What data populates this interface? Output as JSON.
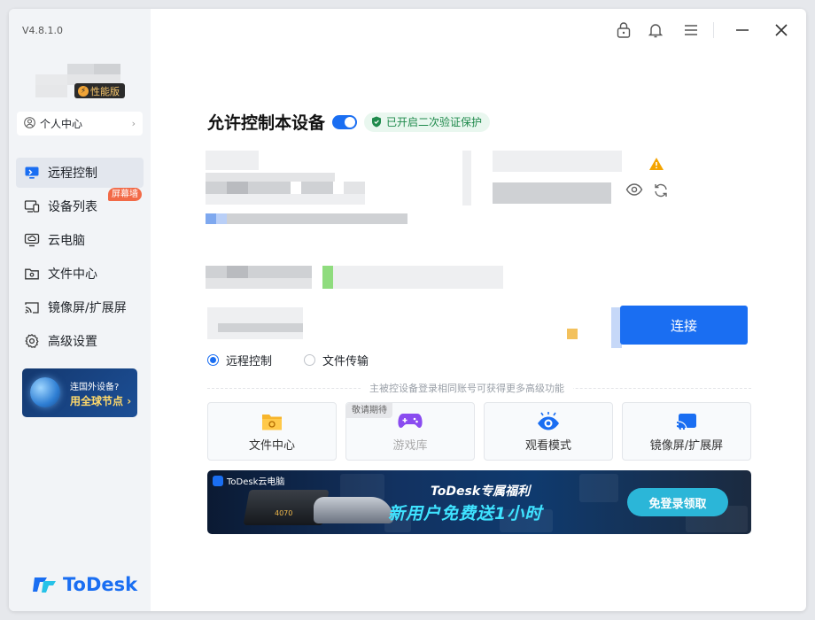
{
  "version": "V4.8.1.0",
  "badge": {
    "perf": "性能版"
  },
  "personal_center": "个人中心",
  "nav": [
    {
      "label": "远程控制",
      "icon": "monitor-icon",
      "active": true
    },
    {
      "label": "设备列表",
      "icon": "devices-icon",
      "tag": "屏幕墙"
    },
    {
      "label": "云电脑",
      "icon": "cloud-pc-icon"
    },
    {
      "label": "文件中心",
      "icon": "folder-icon"
    },
    {
      "label": "镜像屏/扩展屏",
      "icon": "cast-icon"
    },
    {
      "label": "高级设置",
      "icon": "gear-icon"
    }
  ],
  "promo": {
    "line1": "连国外设备?",
    "line2": "用全球节点"
  },
  "logo": "ToDesk",
  "main": {
    "title": "允许控制本设备",
    "verify_badge": "已开启二次验证保护",
    "connect_label": "连接",
    "radio_remote": "远程控制",
    "radio_file": "文件传输",
    "divider_text": "主被控设备登录相同账号可获得更多高级功能",
    "cards": [
      {
        "label": "文件中心",
        "icon": "folder-icon"
      },
      {
        "label": "游戏库",
        "icon": "gamepad-icon",
        "tag": "敬请期待",
        "disabled": true
      },
      {
        "label": "观看模式",
        "icon": "eye-icon"
      },
      {
        "label": "镜像屏/扩展屏",
        "icon": "cast-icon"
      }
    ],
    "banner": {
      "brand": "ToDesk云电脑",
      "line1": "ToDesk专属福利",
      "line2": "新用户免费送1小时",
      "cta": "免登录领取",
      "gpu": "4070"
    }
  },
  "colors": {
    "accent": "#1a6ef2",
    "verify": "#1f8a4c",
    "tag": "#f26a47"
  }
}
